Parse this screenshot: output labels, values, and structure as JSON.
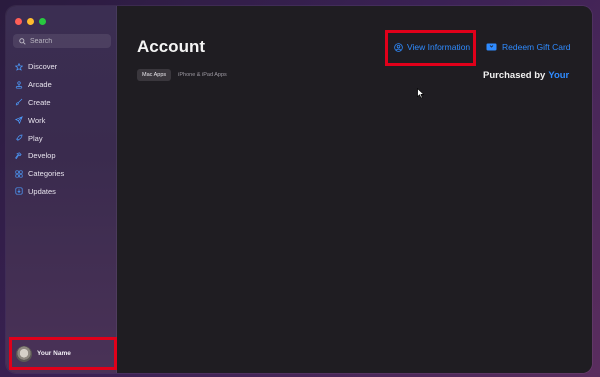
{
  "colors": {
    "accent": "#2f8bff",
    "highlight_box": "#e0001a",
    "traffic_red": "#ff5f57",
    "traffic_yellow": "#febc2e",
    "traffic_green": "#28c840"
  },
  "sidebar": {
    "search_placeholder": "Search",
    "items": [
      {
        "label": "Discover",
        "icon": "star-icon"
      },
      {
        "label": "Arcade",
        "icon": "joystick-icon"
      },
      {
        "label": "Create",
        "icon": "brush-icon"
      },
      {
        "label": "Work",
        "icon": "paperplane-icon"
      },
      {
        "label": "Play",
        "icon": "rocket-icon"
      },
      {
        "label": "Develop",
        "icon": "hammer-icon"
      },
      {
        "label": "Categories",
        "icon": "grid-icon"
      },
      {
        "label": "Updates",
        "icon": "download-icon"
      }
    ],
    "profile_name": "Your Name"
  },
  "main": {
    "title": "Account",
    "view_information": "View Information",
    "redeem_gift_card": "Redeem Gift Card",
    "segments": [
      "Mac Apps",
      "iPhone & iPad Apps"
    ],
    "active_segment": "Mac Apps",
    "purchased_by_label": "Purchased by",
    "purchased_by_value": "Your"
  }
}
